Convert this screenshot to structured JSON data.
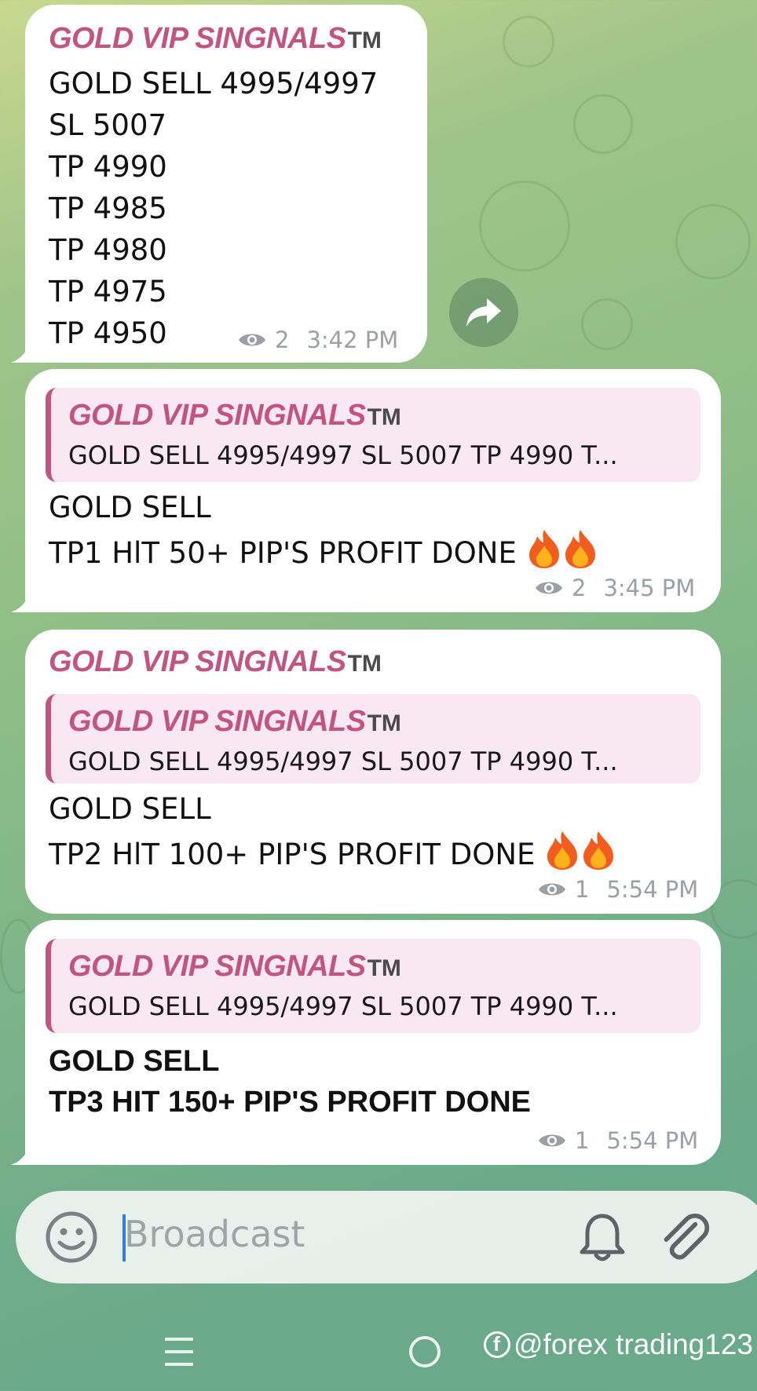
{
  "messages": [
    {
      "channel": "GOLD VIP SINGNALS",
      "tm": "TM",
      "lines": [
        "GOLD SELL 4995/4997",
        "SL 5007",
        "TP 4990",
        "TP 4985",
        "TP 4980",
        "TP 4975",
        "TP 4950"
      ],
      "views": "2",
      "time": "3:42 PM"
    },
    {
      "reply": {
        "channel": "GOLD VIP SINGNALS",
        "tm": "TM",
        "snippet": "GOLD SELL 4995/4997 SL 5007 TP 4990 T..."
      },
      "lines": [
        "GOLD SELL",
        "TP1 HlT 50+ PIP'S PROFIT DONE "
      ],
      "views": "2",
      "time": "3:45 PM"
    },
    {
      "channel": "GOLD VIP SINGNALS",
      "tm": "TM",
      "reply": {
        "channel": "GOLD VIP SINGNALS",
        "tm": "TM",
        "snippet": "GOLD SELL 4995/4997 SL 5007 TP 4990 T..."
      },
      "lines": [
        "GOLD SELL",
        "TP2 HlT 100+ PIP'S PROFIT DONE "
      ],
      "views": "1",
      "time": "5:54 PM"
    },
    {
      "reply": {
        "channel": "GOLD VIP SINGNALS",
        "tm": "TM",
        "snippet": "GOLD SELL 4995/4997 SL 5007 TP 4990 T..."
      },
      "lines": [
        "GOLD SELL",
        "TP3 HIT 150+ PIP'S PROFIT DONE"
      ],
      "views": "1",
      "time": "5:54 PM"
    }
  ],
  "composer": {
    "placeholder": "Broadcast"
  },
  "watermark": "@forex trading123",
  "icons": {
    "emoji": "smiley-face-icon",
    "bell": "bell-icon",
    "attach": "paperclip-icon",
    "forward": "share-arrow-icon",
    "views": "eye-icon",
    "fire": "fire-emoji-icon"
  },
  "colors": {
    "channel_name": "#c2557f",
    "reply_background": "#f9e8f1",
    "meta_text": "#9aa0a6",
    "caret": "#3a7bd5"
  }
}
